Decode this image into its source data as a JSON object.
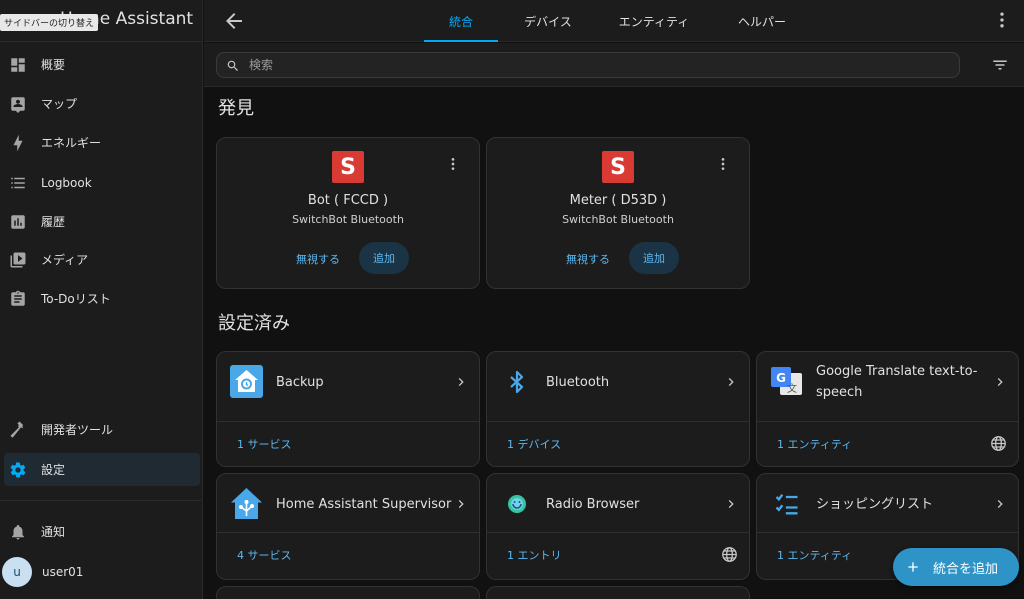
{
  "sidebar": {
    "title": "Home Assistant",
    "tooltip": "サイドバーの切り替え",
    "items": [
      {
        "label": "概要",
        "icon": "dashboard-icon"
      },
      {
        "label": "マップ",
        "icon": "map-account-icon"
      },
      {
        "label": "エネルギー",
        "icon": "lightning-icon"
      },
      {
        "label": "Logbook",
        "icon": "list-icon"
      },
      {
        "label": "履歴",
        "icon": "chart-box-icon"
      },
      {
        "label": "メディア",
        "icon": "play-box-icon"
      },
      {
        "label": "To-Doリスト",
        "icon": "clipboard-list-icon"
      }
    ],
    "dev_tools": "開発者ツール",
    "settings": "設定",
    "notifications": "通知",
    "user": {
      "initial": "u",
      "name": "user01"
    }
  },
  "topbar": {
    "tabs": [
      "統合",
      "デバイス",
      "エンティティ",
      "ヘルパー"
    ],
    "active_tab": "統合"
  },
  "search": {
    "placeholder": "検索"
  },
  "discovered": {
    "heading": "発見",
    "cards": [
      {
        "name": "Bot ( FCCD )",
        "integration": "SwitchBot Bluetooth",
        "ignore": "無視する",
        "add": "追加",
        "logo_letter": "S"
      },
      {
        "name": "Meter ( D53D )",
        "integration": "SwitchBot Bluetooth",
        "ignore": "無視する",
        "add": "追加",
        "logo_letter": "S"
      }
    ]
  },
  "configured": {
    "heading": "設定済み",
    "cards": [
      {
        "name": "Backup",
        "link": "1 サービス",
        "icon": "backup-house-icon",
        "cloud": false
      },
      {
        "name": "Bluetooth",
        "link": "1 デバイス",
        "icon": "bluetooth-icon",
        "cloud": false
      },
      {
        "name": "Google Translate text-to-speech",
        "link": "1 エンティティ",
        "icon": "google-translate-icon",
        "cloud": true
      },
      {
        "name": "Home Assistant Supervisor",
        "link": "4 サービス",
        "icon": "supervisor-house-icon",
        "cloud": false
      },
      {
        "name": "Radio Browser",
        "link": "1 エントリ",
        "icon": "radio-browser-icon",
        "cloud": true
      },
      {
        "name": "ショッピングリスト",
        "link": "1 エンティティ",
        "icon": "checklist-icon",
        "cloud": false
      }
    ]
  },
  "fab": {
    "label": "統合を追加"
  },
  "colors": {
    "accent": "#03a9f4",
    "fab": "#2e94c8",
    "switchbot_red": "#d93a34",
    "link": "#5cb8f0"
  }
}
